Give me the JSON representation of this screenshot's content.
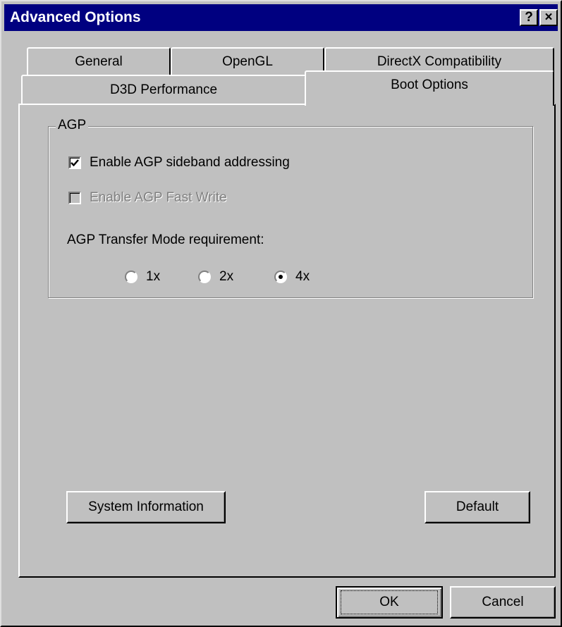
{
  "window": {
    "title": "Advanced Options",
    "help_button": "?",
    "close_button": "×"
  },
  "tabs": {
    "row1": [
      "General",
      "OpenGL",
      "DirectX Compatibility"
    ],
    "row2": [
      "D3D Performance",
      "Boot Options"
    ],
    "selected": "Boot Options"
  },
  "agp_group": {
    "label": "AGP",
    "sideband": {
      "label": "Enable AGP sideband addressing",
      "checked": true,
      "enabled": true
    },
    "fast_write": {
      "label": "Enable AGP Fast Write",
      "checked": false,
      "enabled": false
    },
    "transfer_mode_label": "AGP Transfer Mode requirement:",
    "modes": [
      {
        "label": "1x",
        "selected": false
      },
      {
        "label": "2x",
        "selected": false
      },
      {
        "label": "4x",
        "selected": true
      }
    ]
  },
  "panel_buttons": {
    "system_information": "System Information",
    "default": "Default"
  },
  "dialog_buttons": {
    "ok": "OK",
    "cancel": "Cancel"
  }
}
